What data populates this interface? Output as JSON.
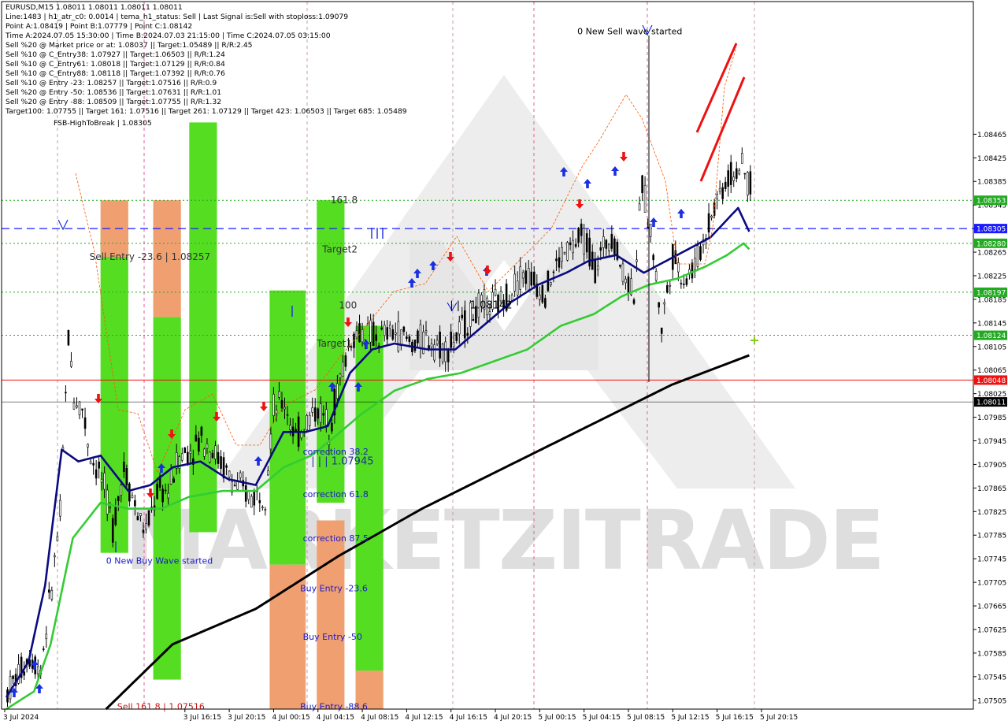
{
  "info_lines": [
    "EURUSD,M15  1.08011 1.08011 1.08011 1.08011",
    "Line:1483  | h1_atr_c0: 0.0014  | tema_h1_status: Sell  | Last Signal is:Sell with stoploss:1.09079",
    "Point A:1.08419  | Point B:1.07779  | Point C:1.08142",
    "Time A:2024.07.05 15:30:00  | Time B:2024.07.03 21:15:00  | Time C:2024.07.05 03:15:00",
    "Sell %20 @ Market price or at: 1.08037  || Target:1.05489  || R/R:2.45",
    "Sell %10 @ C_Entry38: 1.07927  || Target:1.06503  || R/R:1.24",
    "Sell %10 @ C_Entry61: 1.08018  || Target:1.07129  || R/R:0.84",
    "Sell %10 @ C_Entry88: 1.08118  || Target:1.07392  || R/R:0.76",
    "Sell %10 @ Entry -23: 1.08257  || Target:1.07516  || R/R:0.9",
    "Sell %20 @ Entry -50: 1.08536  || Target:1.07631  || R/R:1.01",
    "Sell %20 @ Entry -88: 1.08509  || Target:1.07755  || R/R:1.32",
    "Target100: 1.07755  || Target 161: 1.07516  || Target 261: 1.07129  || Target 423: 1.06503  || Target 685: 1.05489"
  ],
  "fsb_label": "FSB-HighToBreak  | 1.08305",
  "watermark": "MARKETZITRADE",
  "chart_data": {
    "type": "candlestick",
    "symbol": "EURUSD",
    "timeframe": "M15",
    "ylim": [
      1.0749,
      1.0869
    ],
    "y_ticks": [
      "1.08465",
      "1.08425",
      "1.08385",
      "1.08345",
      "1.08305",
      "1.08265",
      "1.08225",
      "1.08185",
      "1.08145",
      "1.08105",
      "1.08065",
      "1.08025",
      "1.07985",
      "1.07945",
      "1.07905",
      "1.07865",
      "1.07825",
      "1.07785",
      "1.07745",
      "1.07705",
      "1.07665",
      "1.07625",
      "1.07585",
      "1.07545",
      "1.07505"
    ],
    "x_ticks": [
      {
        "label": "3 Jul 2024",
        "t": 0
      },
      {
        "label": "3 Jul 16:15",
        "t": 65
      },
      {
        "label": "3 Jul 20:15",
        "t": 81
      },
      {
        "label": "4 Jul 00:15",
        "t": 97
      },
      {
        "label": "4 Jul 04:15",
        "t": 113
      },
      {
        "label": "4 Jul 08:15",
        "t": 129
      },
      {
        "label": "4 Jul 12:15",
        "t": 145
      },
      {
        "label": "4 Jul 16:15",
        "t": 161
      },
      {
        "label": "4 Jul 20:15",
        "t": 177
      },
      {
        "label": "5 Jul 00:15",
        "t": 193
      },
      {
        "label": "5 Jul 04:15",
        "t": 209
      },
      {
        "label": "5 Jul 08:15",
        "t": 225
      },
      {
        "label": "5 Jul 12:15",
        "t": 241
      },
      {
        "label": "5 Jul 16:15",
        "t": 257
      },
      {
        "label": "5 Jul 20:15",
        "t": 273
      }
    ],
    "price_tags": [
      {
        "price": 1.08353,
        "label": "1.08353",
        "color": "#22aa22",
        "line": "dotted"
      },
      {
        "price": 1.08305,
        "label": "1.08305",
        "color": "#1a1aff",
        "line": "dashed"
      },
      {
        "price": 1.0828,
        "label": "1.08280",
        "color": "#22aa22",
        "line": "dotted"
      },
      {
        "price": 1.08197,
        "label": "1.08197",
        "color": "#22aa22",
        "line": "dotted"
      },
      {
        "price": 1.08124,
        "label": "1.08124",
        "color": "#22aa22",
        "line": "dotted"
      },
      {
        "price": 1.08048,
        "label": "1.08048",
        "color": "#ee1111",
        "line": "solid"
      },
      {
        "price": 1.08011,
        "label": "1.08011",
        "color": "#000000",
        "line": "solid-thin"
      }
    ],
    "zones": [
      {
        "t0": 34,
        "t1": 44,
        "lo": 1.07755,
        "hi": 1.08305,
        "color": "#55dd22"
      },
      {
        "t0": 34,
        "t1": 44,
        "lo": 1.08257,
        "hi": 1.08353,
        "color": "#f0a070"
      },
      {
        "t0": 53,
        "t1": 63,
        "lo": 1.0754,
        "hi": 1.08155,
        "color": "#55dd22"
      },
      {
        "t0": 53,
        "t1": 63,
        "lo": 1.08155,
        "hi": 1.08353,
        "color": "#f0a070"
      },
      {
        "t0": 66,
        "t1": 76,
        "lo": 1.0779,
        "hi": 1.08485,
        "color": "#55dd22"
      },
      {
        "t0": 95,
        "t1": 108,
        "lo": 1.07735,
        "hi": 1.082,
        "color": "#55dd22"
      },
      {
        "t0": 95,
        "t1": 108,
        "lo": 1.0749,
        "hi": 1.07735,
        "color": "#f0a070"
      },
      {
        "t0": 112,
        "t1": 122,
        "lo": 1.0784,
        "hi": 1.08353,
        "color": "#55dd22"
      },
      {
        "t0": 112,
        "t1": 122,
        "lo": 1.0749,
        "hi": 1.0781,
        "color": "#f0a070"
      },
      {
        "t0": 126,
        "t1": 136,
        "lo": 1.07555,
        "hi": 1.0814,
        "color": "#55dd22"
      },
      {
        "t0": 126,
        "t1": 136,
        "lo": 1.0749,
        "hi": 1.07555,
        "color": "#f0a070"
      }
    ],
    "level_labels": [
      {
        "text": "Sell Entry -23.6 | 1.08257",
        "t": 30,
        "price": 1.08257,
        "color": "#333333",
        "size": 12
      },
      {
        "text": "161.8",
        "t": 117,
        "price": 1.08353,
        "color": "#333333",
        "size": 12
      },
      {
        "text": "Target2",
        "t": 114,
        "price": 1.0827,
        "color": "#333333",
        "size": 12
      },
      {
        "text": "100",
        "t": 120,
        "price": 1.08175,
        "color": "#333333",
        "size": 12
      },
      {
        "text": "Target1",
        "t": 112,
        "price": 1.0811,
        "color": "#333333",
        "size": 12
      },
      {
        "text": "| | | 1.08142",
        "t": 160,
        "price": 1.08175,
        "color": "#000000",
        "size": 13
      },
      {
        "text": "| | | 1.07945",
        "t": 110,
        "price": 1.0791,
        "color": "#1a3399",
        "size": 13
      },
      {
        "text": "correction 38.2",
        "t": 107,
        "price": 1.07927,
        "color": "#1a1acc",
        "size": 11
      },
      {
        "text": "correction 61.8",
        "t": 107,
        "price": 1.07855,
        "color": "#1a1acc",
        "size": 11
      },
      {
        "text": "correction 87.5",
        "t": 107,
        "price": 1.0778,
        "color": "#1a1acc",
        "size": 11
      },
      {
        "text": "Buy Entry -23.6",
        "t": 106,
        "price": 1.07695,
        "color": "#1a1acc",
        "size": 11
      },
      {
        "text": "Buy Entry -50",
        "t": 107,
        "price": 1.07613,
        "color": "#1a1acc",
        "size": 11
      },
      {
        "text": "Buy Entry -88.6",
        "t": 106,
        "price": 1.07495,
        "color": "#1a1acc",
        "size": 11
      },
      {
        "text": "0 New Buy Wave started",
        "t": 36,
        "price": 1.07742,
        "color": "#1a1acc",
        "size": 11
      },
      {
        "text": "0 New Sell wave started",
        "t": 206,
        "price": 1.0864,
        "color": "#000000",
        "size": 11
      },
      {
        "text": "Sell 161.8 | 1.07516",
        "t": 40,
        "price": 1.07495,
        "color": "#cc1111",
        "size": 11
      }
    ],
    "series": [
      {
        "name": "ma_fast_navy",
        "color": "#0a0a80",
        "width": 2.6
      },
      {
        "name": "ma_mid_green",
        "color": "#33cc33",
        "width": 2.6
      },
      {
        "name": "ma_slow_black",
        "color": "#000000",
        "width": 3
      }
    ]
  }
}
